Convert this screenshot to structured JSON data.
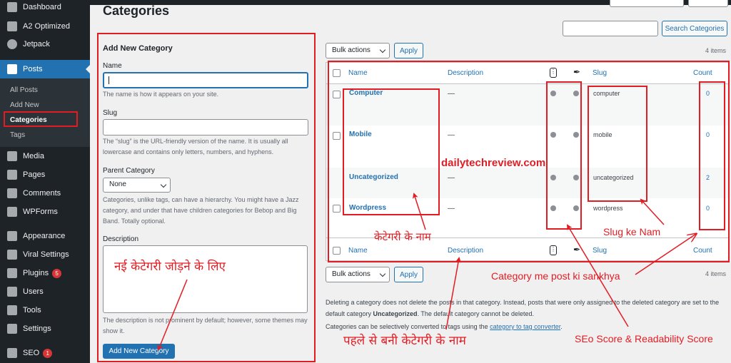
{
  "sidebar": {
    "items": [
      {
        "label": "Dashboard",
        "icon": "dashboard-icon"
      },
      {
        "label": "A2 Optimized",
        "icon": "gear-icon"
      },
      {
        "label": "Jetpack",
        "icon": "jetpack-icon"
      },
      {
        "label": "Posts",
        "icon": "pin-icon"
      },
      {
        "label": "Media",
        "icon": "media-icon"
      },
      {
        "label": "Pages",
        "icon": "pages-icon"
      },
      {
        "label": "Comments",
        "icon": "comment-icon"
      },
      {
        "label": "WPForms",
        "icon": "forms-icon"
      },
      {
        "label": "Appearance",
        "icon": "brush-icon"
      },
      {
        "label": "Viral Settings",
        "icon": "gear-icon"
      },
      {
        "label": "Plugins",
        "icon": "plugin-icon",
        "badge": "5"
      },
      {
        "label": "Users",
        "icon": "user-icon"
      },
      {
        "label": "Tools",
        "icon": "wrench-icon"
      },
      {
        "label": "Settings",
        "icon": "settings-icon"
      },
      {
        "label": "SEO",
        "icon": "yoast-icon",
        "badge": "1"
      }
    ],
    "posts_submenu": [
      "All Posts",
      "Add New",
      "Categories",
      "Tags"
    ]
  },
  "page": {
    "title": "Categories"
  },
  "form": {
    "heading": "Add New Category",
    "name_label": "Name",
    "name_hint": "The name is how it appears on your site.",
    "slug_label": "Slug",
    "slug_hint": "The “slug” is the URL-friendly version of the name. It is usually all lowercase and contains only letters, numbers, and hyphens.",
    "parent_label": "Parent Category",
    "parent_value": "None",
    "parent_hint": "Categories, unlike tags, can have a hierarchy. You might have a Jazz category, and under that have children categories for Bebop and Big Band. Totally optional.",
    "desc_label": "Description",
    "desc_hint": "The description is not prominent by default; however, some themes may show it.",
    "submit_label": "Add New Category"
  },
  "search": {
    "button_label": "Search Categories"
  },
  "bulk": {
    "select_label": "Bulk actions",
    "apply_label": "Apply",
    "items_count": "4 items"
  },
  "table": {
    "columns": {
      "name": "Name",
      "description": "Description",
      "slug": "Slug",
      "count": "Count"
    },
    "rows": [
      {
        "name": "Computer",
        "description": "—",
        "slug": "computer",
        "count": "0"
      },
      {
        "name": "Mobile",
        "description": "—",
        "slug": "mobile",
        "count": "0"
      },
      {
        "name": "Uncategorized",
        "description": "—",
        "slug": "uncategorized",
        "count": "2"
      },
      {
        "name": "Wordpress",
        "description": "—",
        "slug": "wordpress",
        "count": "0"
      }
    ]
  },
  "footnote": {
    "line1a": "Deleting a category does not delete the posts in that category. Instead, posts that were only assigned to the deleted category are set to the default category ",
    "line1b": "Uncategorized",
    "line1c": ". The default category cannot be deleted.",
    "line2a": "Categories can be selectively converted to tags using the ",
    "line2link": "category to tag converter",
    "line2b": "."
  },
  "annotations": {
    "watermark": "dailytechreview.com",
    "add_new": "नई केटेगरी जोड़ने के लिए",
    "category_name": "केटेगरी के नाम",
    "slug_name": "Slug ke Nam",
    "post_count": "Category me post ki sankhya",
    "existing": "पहले से बनी  केटेगरी के नाम",
    "seo_score": "SEo Score & Readability Score"
  },
  "colors": {
    "accent": "#2271b1",
    "annotation": "#e31c23",
    "sidebar": "#1d2327"
  }
}
